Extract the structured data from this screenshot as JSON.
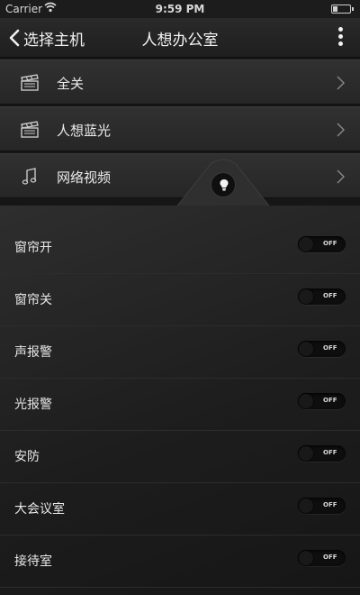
{
  "statusbar": {
    "carrier": "Carrier",
    "time": "9:59 PM"
  },
  "navbar": {
    "back_label": "选择主机",
    "title": "人想办公室"
  },
  "scenes": [
    {
      "label": "全关",
      "icon": "clapperboard-icon"
    },
    {
      "label": "人想蓝光",
      "icon": "clapperboard-icon"
    },
    {
      "label": "网络视频",
      "icon": "music-note-icon"
    }
  ],
  "panel": {
    "tab_icon": "lightbulb-icon"
  },
  "devices": [
    {
      "label": "窗帘开",
      "state": "OFF"
    },
    {
      "label": "窗帘关",
      "state": "OFF"
    },
    {
      "label": "声报警",
      "state": "OFF"
    },
    {
      "label": "光报警",
      "state": "OFF"
    },
    {
      "label": "安防",
      "state": "OFF"
    },
    {
      "label": "大会议室",
      "state": "OFF"
    },
    {
      "label": "接待室",
      "state": "OFF"
    }
  ],
  "colors": {
    "background": "#161616",
    "row": "#2b2b2b",
    "text": "#e8e8e8"
  }
}
